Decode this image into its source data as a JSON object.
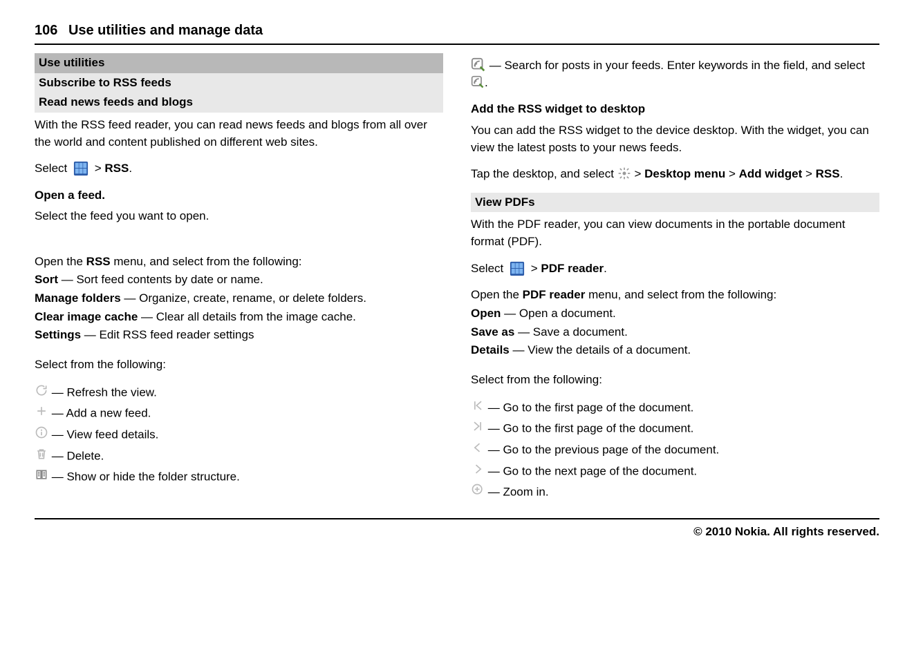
{
  "header": {
    "page_number": "106",
    "title": "Use utilities and manage data"
  },
  "left": {
    "sec1": "Use utilities",
    "sec2": "Subscribe to RSS feeds",
    "sec3": "Read news feeds and blogs",
    "intro": "With the RSS feed reader, you can read news feeds and blogs from all over the world and content published on different web sites.",
    "select_prefix": "Select ",
    "select_sep": " > ",
    "rss_label": "RSS",
    "period": ".",
    "open_feed_h": "Open a feed.",
    "open_feed_t": "Select the feed you want to open.",
    "rss_menu_intro_a": "Open the ",
    "rss_menu_intro_b": "RSS",
    "rss_menu_intro_c": " menu, and select from the following:",
    "items": {
      "sort_l": "Sort",
      "sort_t": "  — Sort feed contents by date or name.",
      "mf_l": "Manage folders",
      "mf_t": "  — Organize, create, rename, or delete folders.",
      "cic_l": "Clear image cache",
      "cic_t": "  — Clear all details from the image cache.",
      "set_l": "Settings",
      "set_t": "  — Edit RSS feed reader settings"
    },
    "select_from": "Select from the following:",
    "icons": {
      "refresh": " — Refresh the view.",
      "add": " — Add a new feed.",
      "info": " — View feed details.",
      "delete": " — Delete.",
      "folder": " — Show or hide the folder structure."
    }
  },
  "right": {
    "search_a": " — Search for posts in your feeds. Enter keywords in the field, and select ",
    "search_b": ".",
    "add_widget_h": "Add the RSS widget to desktop",
    "add_widget_t": "You can add the RSS widget to the device desktop. With the widget, you can view the latest posts to your news feeds.",
    "tap_a": "Tap the desktop, and select ",
    "tap_sep": " > ",
    "dm": "Desktop menu",
    "aw": "Add widget",
    "rss": "RSS",
    "period": ".",
    "view_pdfs_h": "View PDFs",
    "view_pdfs_t": "With the PDF reader, you can view documents in the portable document format (PDF).",
    "select_prefix": "Select ",
    "pdf_label": "PDF reader",
    "pdf_menu_a": "Open the ",
    "pdf_menu_b": "PDF reader",
    "pdf_menu_c": " menu, and select from the following:",
    "items": {
      "open_l": "Open",
      "open_t": "  — Open a document.",
      "save_l": "Save as",
      "save_t": "  — Save a document.",
      "det_l": "Details",
      "det_t": "  — View the details of a document."
    },
    "select_from": "Select from the following:",
    "icons": {
      "first": " — Go to the first page of the document.",
      "first2": " — Go to the first page of the document.",
      "prev": " — Go to the previous page of the document.",
      "next": " — Go to the next page of the document.",
      "zoom": " — Zoom in."
    }
  },
  "footer": "© 2010 Nokia. All rights reserved."
}
